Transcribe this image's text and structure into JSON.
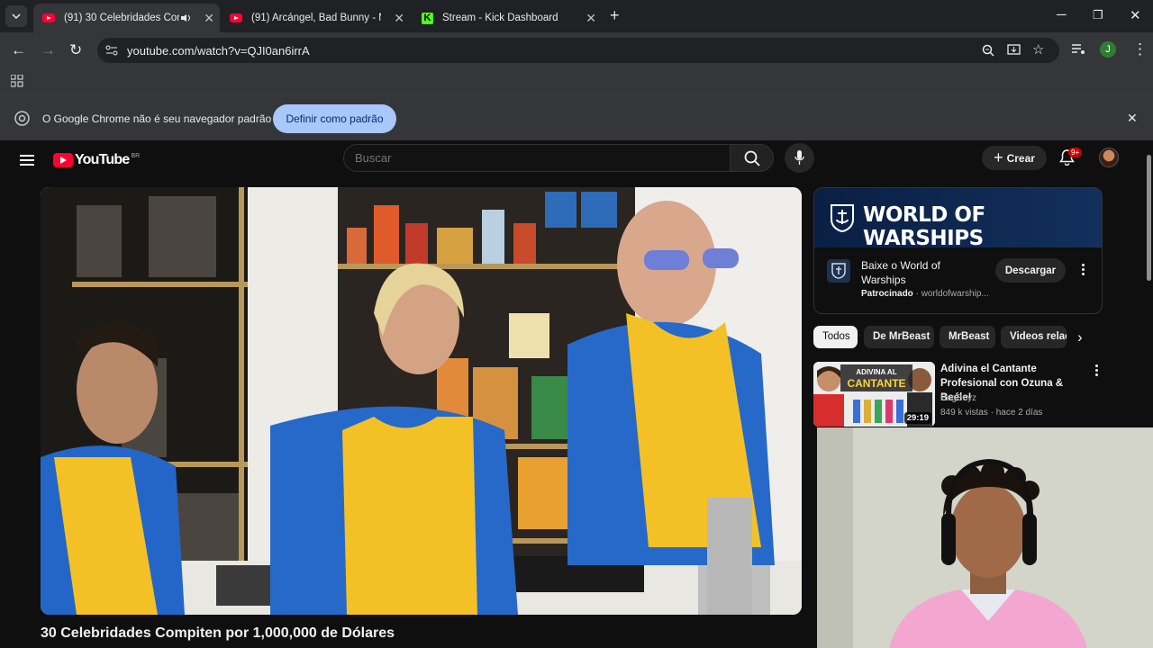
{
  "browser": {
    "tabs": [
      {
        "title": "(91) 30 Celebridades Comp",
        "icon": "youtube-favicon",
        "audio": true,
        "active": true
      },
      {
        "title": "(91) Arcángel, Bad Bunny - Me",
        "icon": "youtube-favicon",
        "active": false
      },
      {
        "title": "Stream - Kick Dashboard",
        "icon": "kick-favicon",
        "active": false
      }
    ],
    "new_tab_label": "+",
    "url": "youtube.com/watch?v=QJI0an6irrA",
    "profile_initial": "J",
    "infobar": {
      "message": "O Google Chrome não é seu navegador padrão",
      "button": "Definir como padrão"
    }
  },
  "youtube": {
    "logo_text": "YouTube",
    "country_code": "BR",
    "search_placeholder": "Buscar",
    "create_label": "Crear",
    "notification_badge": "9+",
    "video_title": "30 Celebridades Compiten por 1,000,000 de Dólares",
    "ad": {
      "banner_text": "WORLD OF WARSHIPS",
      "title": "Baixe o World of Warships",
      "sponsored_label": "Patrocinado",
      "domain": "worldofwarship...",
      "cta": "Descargar"
    },
    "chips": [
      "Todos",
      "De MrBeast",
      "MrBeast",
      "Videos relac"
    ],
    "recommendation": {
      "title": "Adivina el Cantante Profesional con Ozuna & Beéle!",
      "channel": "BagBoyz",
      "stats": "849 k vistas · hace 2 días",
      "duration": "29:19",
      "thumb_text_1": "ADIVINA AL",
      "thumb_text_2": "CANTANTE"
    }
  },
  "colors": {
    "accent_blue": "#a8c7fa",
    "youtube_red": "#ff0033",
    "kick_green": "#53fc18",
    "dark_bg": "#0f0f0f"
  }
}
